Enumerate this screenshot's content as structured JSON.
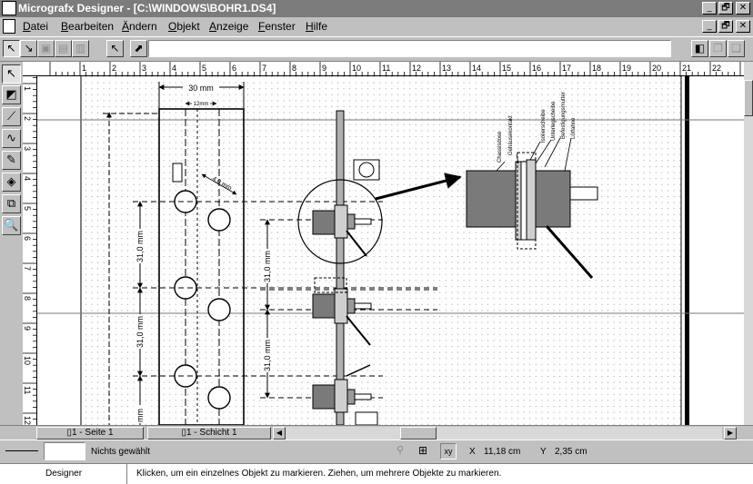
{
  "window": {
    "title": "Micrografx Designer - [C:\\WINDOWS\\BOHR1.DS4]",
    "controls": [
      "_",
      "🗗",
      "✕"
    ]
  },
  "menubar": {
    "doc_icon": "document-icon",
    "items": [
      {
        "pre": "",
        "acc": "D",
        "post": "atei"
      },
      {
        "pre": "",
        "acc": "B",
        "post": "earbeiten"
      },
      {
        "pre": "",
        "acc": "Ä",
        "post": "ndern"
      },
      {
        "pre": "",
        "acc": "O",
        "post": "bjekt"
      },
      {
        "pre": "",
        "acc": "A",
        "post": "nzeige"
      },
      {
        "pre": "",
        "acc": "F",
        "post": "enster"
      },
      {
        "pre": "",
        "acc": "H",
        "post": "ilfe"
      }
    ],
    "controls": [
      "_",
      "🗗",
      "✕"
    ]
  },
  "toolbar": {
    "command_value": ""
  },
  "rulers": {
    "horizontal_labels": [
      "1",
      "2",
      "3",
      "4",
      "5",
      "6",
      "7",
      "8",
      "9",
      "10",
      "11",
      "12",
      "13",
      "14",
      "15",
      "16",
      "17",
      "18",
      "19",
      "20",
      "21",
      "22"
    ],
    "vertical_labels": [
      "1",
      "2",
      "3",
      "4",
      "5",
      "6",
      "7",
      "8",
      "9",
      "10",
      "11",
      "12"
    ]
  },
  "drawing": {
    "dim_30mm": "30 mm",
    "dim_12mm": "12mm",
    "dim_hole": "4,0 mm",
    "dim_31_v1": "31,0 mm",
    "dim_31_v2": "31,0 mm",
    "dim_31_v3": "31,0 mm",
    "dim_31_v4": "31,0 mm",
    "dim_mm_bottom": "mm",
    "callouts": [
      "Chassisdose",
      "Gehäusekontakt",
      "Isolierscheibe",
      "Unterlegscheibe",
      "Befestigungsmutter",
      "Lötfahne"
    ]
  },
  "pagebar": {
    "page_tab": "1 - Seite 1",
    "layer_tab": "1 - Schicht 1"
  },
  "status": {
    "selection": "Nichts gewählt",
    "x_label": "X",
    "x_value": "11,18 cm",
    "y_label": "Y",
    "y_value": "2,35 cm"
  },
  "hint": {
    "app": "Designer",
    "message": "Klicken, um ein einzelnes Objekt zu markieren. Ziehen, um mehrere Objekte zu markieren."
  }
}
